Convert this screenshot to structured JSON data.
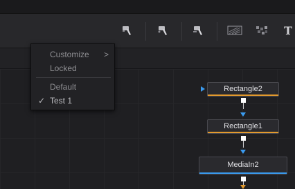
{
  "toolbar": {
    "icons": [
      "paint-brush-icon",
      "paint-brush-icon",
      "paint-brush-icon",
      "background-icon",
      "fast-noise-icon",
      "text-icon"
    ],
    "text_tool_glyph": "T"
  },
  "context_menu": {
    "items": [
      {
        "label": "Customize",
        "has_submenu": true,
        "checked": false,
        "enabled": true
      },
      {
        "label": "Locked",
        "has_submenu": false,
        "checked": false,
        "enabled": true
      },
      {
        "label": "Default",
        "has_submenu": false,
        "checked": false,
        "enabled": true
      },
      {
        "label": "Test 1",
        "has_submenu": false,
        "checked": true,
        "enabled": true
      }
    ],
    "check_glyph": "✓",
    "submenu_glyph": ">"
  },
  "nodes": [
    {
      "name": "Rectangle2",
      "underline_color": "#e39a2d"
    },
    {
      "name": "Rectangle1",
      "underline_color": "#e39a2d"
    },
    {
      "name": "MediaIn2",
      "underline_color": "#3a9bf0"
    }
  ],
  "colors": {
    "accent_blue": "#3a9bf0",
    "mask_orange": "#e39a2d",
    "background": "#1f1f22"
  }
}
